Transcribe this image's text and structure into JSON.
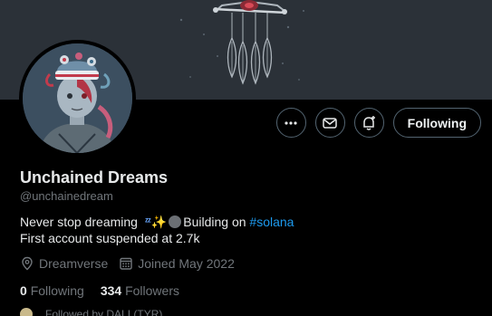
{
  "profile": {
    "name": "Unchained Dreams",
    "handle": "@unchainedream",
    "bio_line1_prefix": "Never stop dreaming ",
    "bio_line1_emoji_zzz": "ᶻᶻ",
    "bio_line1_emoji_spark": "✨",
    "bio_line1_mid": "Building on ",
    "bio_hashtag": "#solana",
    "bio_line2": "First account suspended at 2.7k",
    "location": "Dreamverse",
    "joined": "Joined May 2022",
    "following_count": "0",
    "following_label": "Following",
    "followers_count": "334",
    "followers_label": "Followers",
    "followed_by": "Followed by DALI (TYR)"
  },
  "actions": {
    "more_icon": "more-horizontal-icon",
    "message_icon": "envelope-icon",
    "notify_icon": "bell-plus-icon",
    "follow_label": "Following"
  },
  "colors": {
    "background": "#000000",
    "banner": "#2b3138",
    "text": "#e7e9ea",
    "muted": "#71767b",
    "border": "#536471",
    "link": "#1d9bf0"
  }
}
